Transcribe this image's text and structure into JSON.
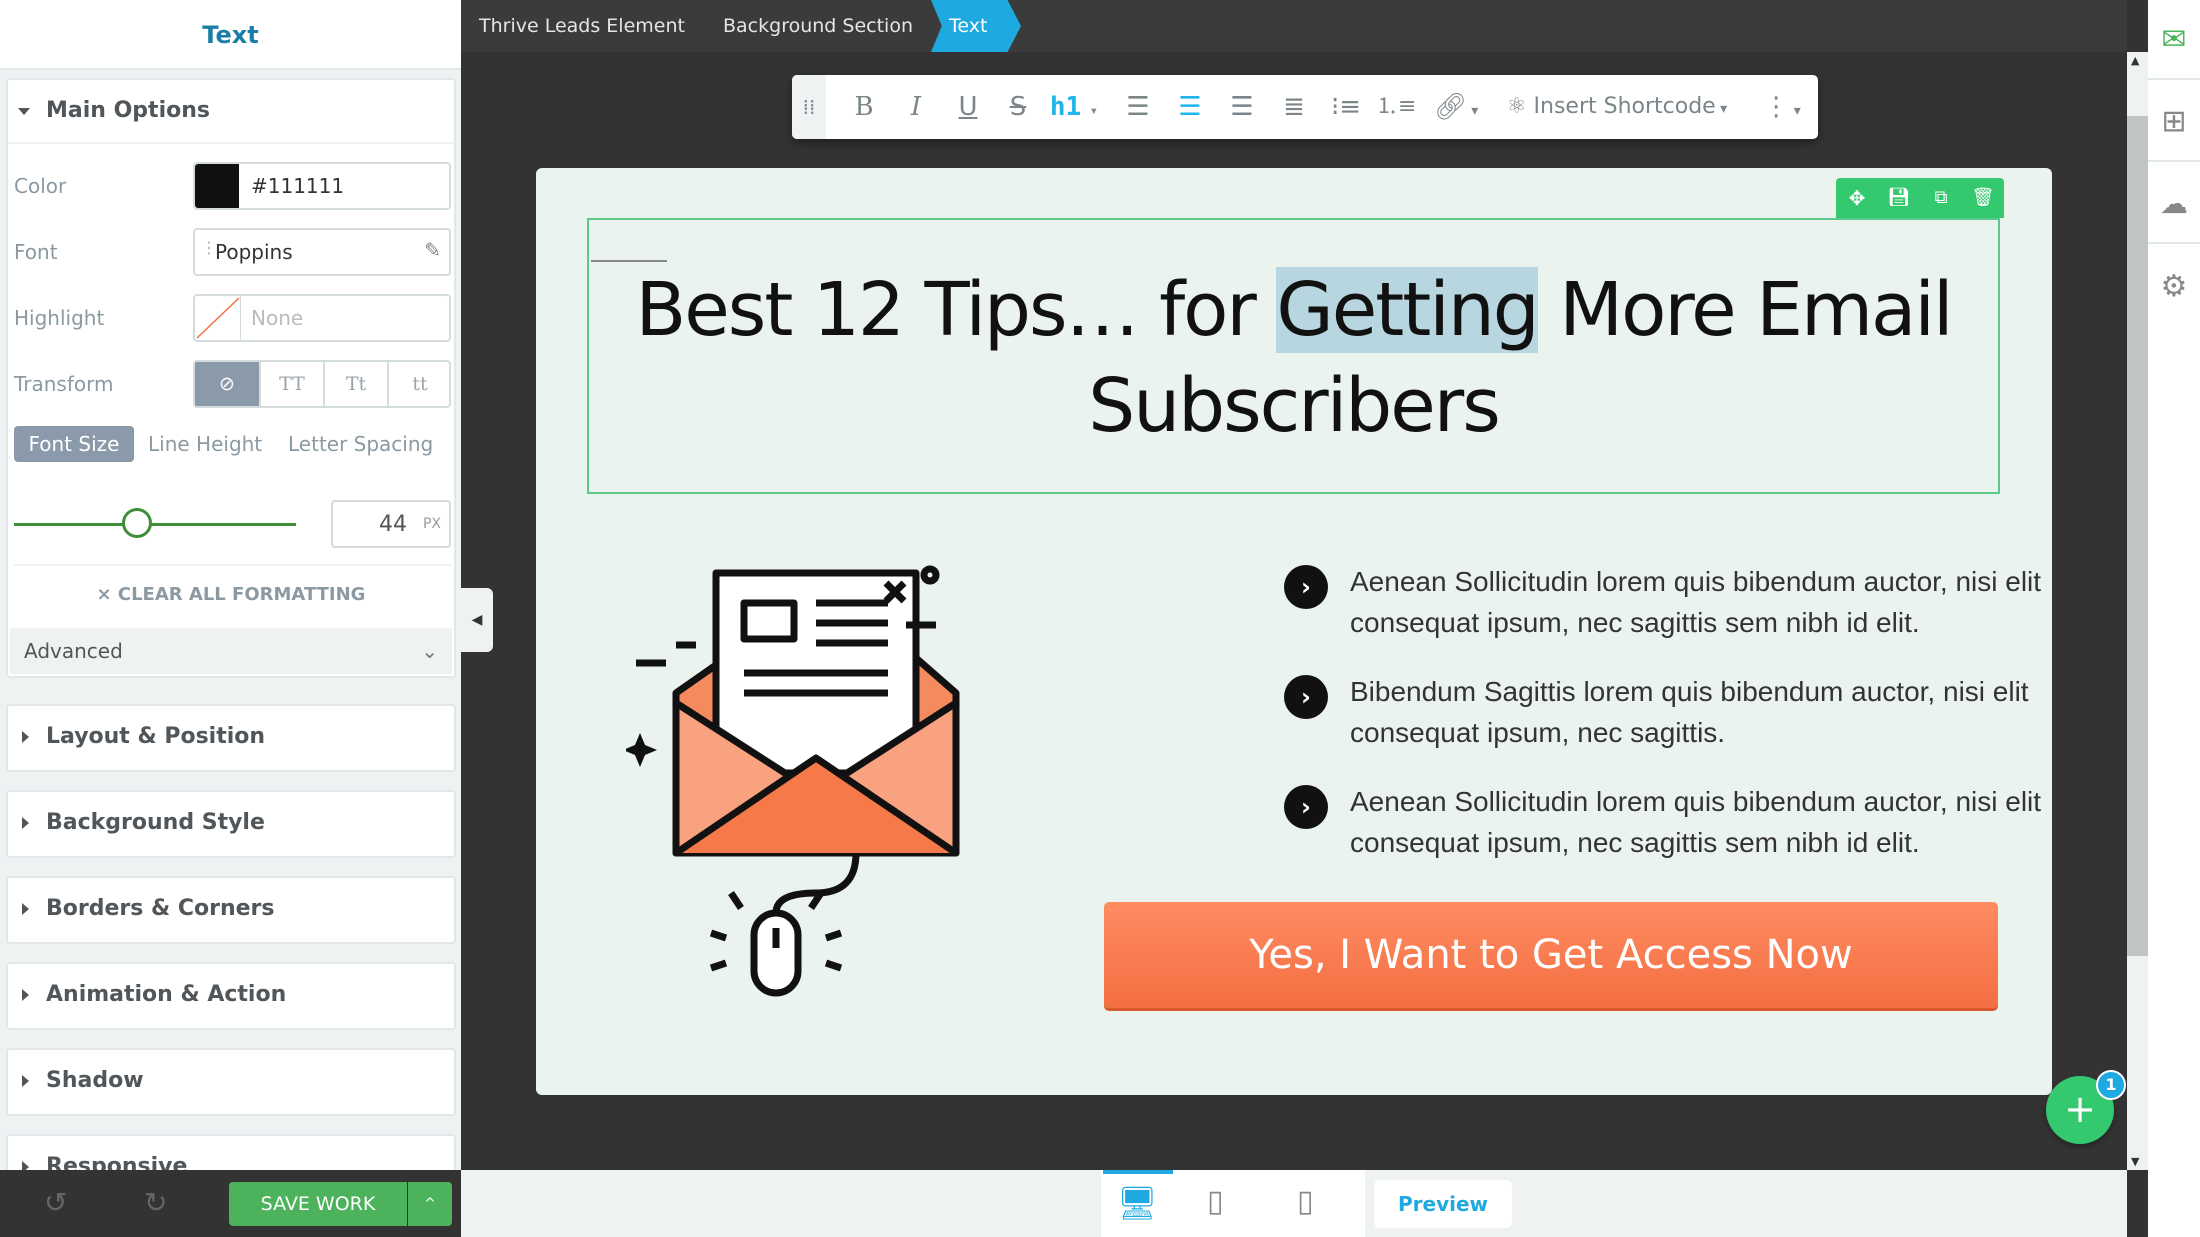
{
  "panel": {
    "title": "Text",
    "main_options": "Main Options",
    "color_label": "Color",
    "color_value": "#111111",
    "font_label": "Font",
    "font_value": "Poppins",
    "highlight_label": "Highlight",
    "highlight_value": "None",
    "transform_label": "Transform",
    "transform_options": [
      "TT",
      "Tt",
      "tt"
    ],
    "size_tabs": [
      "Font Size",
      "Line Height",
      "Letter Spacing"
    ],
    "font_size": "44",
    "font_size_unit": "PX",
    "font_size_slider_fraction": 0.43,
    "clear_formatting": "CLEAR ALL FORMATTING",
    "advanced": "Advanced",
    "sections": [
      "Layout & Position",
      "Background Style",
      "Borders & Corners",
      "Animation & Action",
      "Shadow",
      "Responsive"
    ],
    "save": "SAVE WORK"
  },
  "breadcrumbs": [
    "Thrive Leads Element",
    "Background Section",
    "Text"
  ],
  "toolbar": {
    "heading": "h1",
    "shortcode": "Insert Shortcode",
    "icons": [
      "drag-handle-icon",
      "bold-icon",
      "italic-icon",
      "underline-icon",
      "strikethrough-icon",
      "align-left-icon",
      "align-center-icon",
      "align-right-icon",
      "align-justify-icon",
      "bullet-list-icon",
      "numbered-list-icon",
      "link-icon",
      "shortcode-icon",
      "more-icon"
    ]
  },
  "content": {
    "heading_before": "Best 12 Tips… for ",
    "heading_highlight": "Getting",
    "heading_after": " More Email Subscribers",
    "bullets": [
      {
        "line1": "Aenean Sollicitudin lorem quis bibendum auctor, nisi elit",
        "line2": "consequat ipsum, nec sagittis sem nibh id elit."
      },
      {
        "line1": "Bibendum Sagittis lorem quis bibendum auctor, nisi elit",
        "line2": "consequat ipsum, nec sagittis."
      },
      {
        "line1": "Aenean Sollicitudin lorem quis bibendum auctor, nisi elit",
        "line2": "consequat ipsum, nec sagittis sem nibh id elit."
      }
    ],
    "cta": "Yes, I Want to Get Access Now"
  },
  "bottom": {
    "preview": "Preview"
  },
  "fab": {
    "badge": "1"
  },
  "colors": {
    "accent": "#1fa9e1",
    "green": "#4cb35c",
    "cta": "#f36e41",
    "canvas": "#eaf3ee"
  }
}
